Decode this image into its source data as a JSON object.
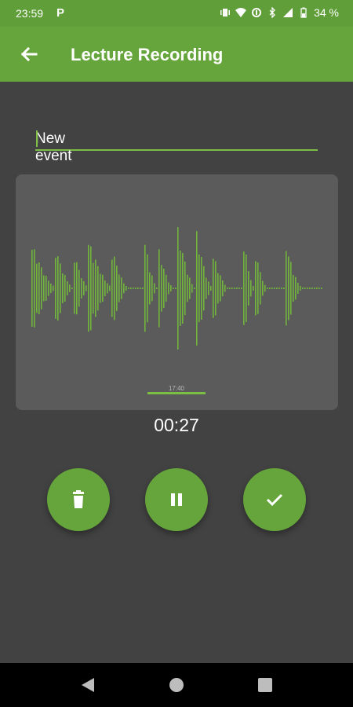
{
  "status_bar": {
    "time": "23:59",
    "app_letter": "P",
    "battery_text": "34 %",
    "icons": [
      "parking-icon",
      "vibrate-icon",
      "wifi-icon",
      "data-saver-icon",
      "bluetooth-icon",
      "signal-icon",
      "battery-icon"
    ]
  },
  "app_bar": {
    "back_icon": "arrow-back-icon",
    "title": "Lecture Recording"
  },
  "recording": {
    "name": "New event",
    "marker_label": "17:40",
    "elapsed": "00:27"
  },
  "controls": {
    "delete_icon": "trash-icon",
    "pause_icon": "pause-icon",
    "confirm_icon": "check-icon"
  },
  "colors": {
    "primary": "#65a53b",
    "status_bar": "#5f9e38",
    "accent": "#7cbd45",
    "background": "#424242",
    "card": "#5b5b5b",
    "waveform": "#72b53c"
  },
  "nav_bar": {
    "icons": [
      "back-triangle-icon",
      "home-circle-icon",
      "recents-square-icon"
    ]
  }
}
